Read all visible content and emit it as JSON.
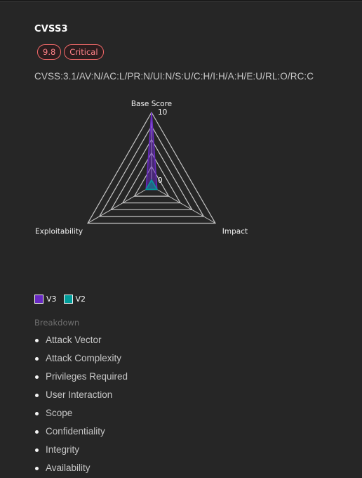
{
  "card": {
    "title": "CVSS3",
    "score_tag": "9.8",
    "severity_tag": "Critical",
    "vector": "CVSS:3.1/AV:N/AC:L/PR:N/UI:N/S:U/C:H/I:H/A:H/E:U/RL:O/RC:C"
  },
  "colors": {
    "severity_critical": "#fa6b6b",
    "v3": "#6929c4",
    "v2": "#009d9a"
  },
  "chart_data": {
    "type": "radar",
    "axes": [
      "Base Score",
      "Impact",
      "Exploitability"
    ],
    "range": [
      0,
      10
    ],
    "tick_labels": [
      "0",
      "10"
    ],
    "grid_levels": [
      0,
      2,
      4,
      6,
      8,
      10
    ],
    "series": [
      {
        "name": "V3",
        "color": "#6929c4",
        "values": [
          10,
          0,
          0
        ]
      },
      {
        "name": "V2",
        "color": "#009d9a",
        "values": [
          0,
          0,
          0
        ]
      }
    ],
    "legend_position": "bottom-left"
  },
  "legend": [
    {
      "label": "V3",
      "color": "#6929c4"
    },
    {
      "label": "V2",
      "color": "#009d9a"
    }
  ],
  "breakdown": {
    "title": "Breakdown",
    "items": [
      "Attack Vector",
      "Attack Complexity",
      "Privileges Required",
      "User Interaction",
      "Scope",
      "Confidentiality",
      "Integrity",
      "Availability"
    ]
  }
}
